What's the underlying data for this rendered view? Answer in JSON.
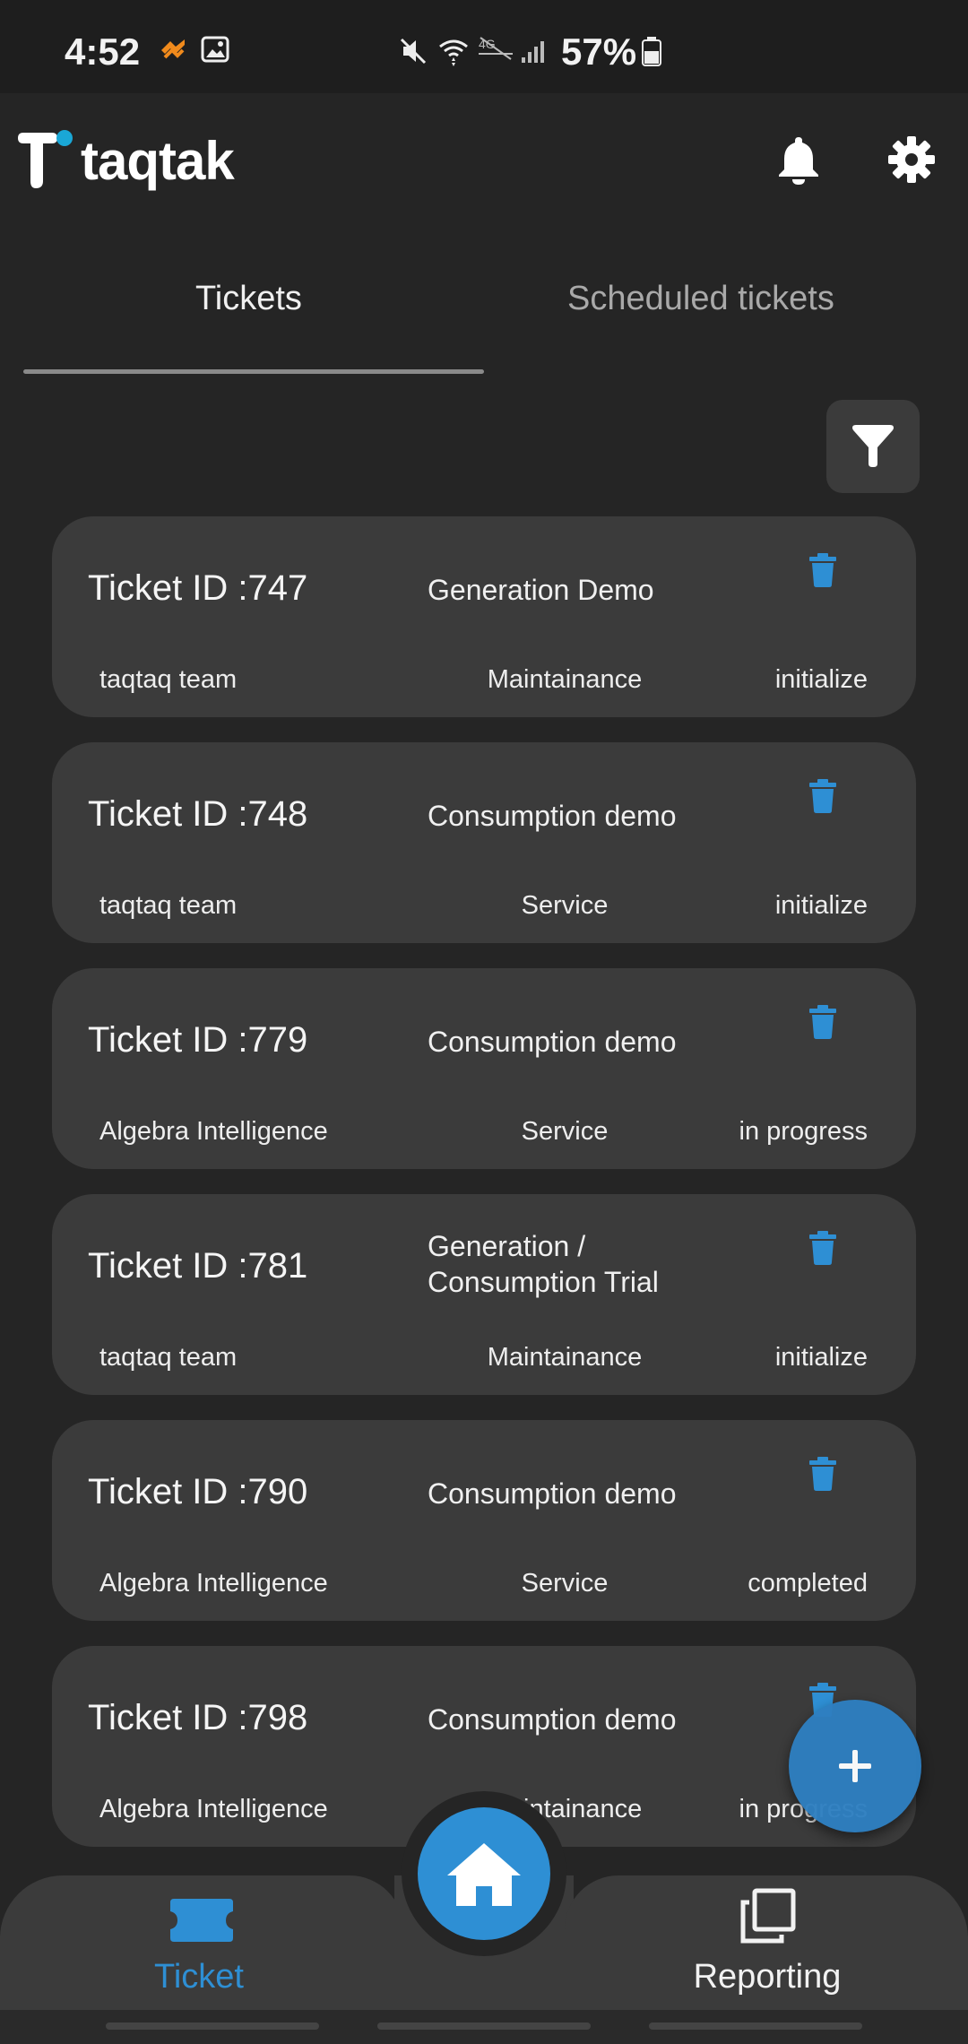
{
  "status_bar": {
    "time": "4:52",
    "battery": "57%",
    "icons": [
      "orange-app-icon",
      "gallery-icon",
      "mute-icon",
      "wifi-icon",
      "4g-icon",
      "signal-icon",
      "battery-icon"
    ]
  },
  "header": {
    "logo_text": "taqtak",
    "icons": [
      "bell-icon",
      "gear-icon"
    ]
  },
  "tabs": [
    {
      "label": "Tickets",
      "active": true
    },
    {
      "label": "Scheduled tickets",
      "active": false
    }
  ],
  "colors": {
    "accent": "#2e8fd4",
    "card": "#3b3b3b",
    "background": "#252525"
  },
  "tickets": [
    {
      "id": "Ticket ID :747",
      "name": "Generation Demo",
      "client": "taqtaq team",
      "type": "Maintainance",
      "status": "initialize"
    },
    {
      "id": "Ticket ID :748",
      "name": "Consumption demo",
      "client": "taqtaq team",
      "type": "Service",
      "status": "initialize"
    },
    {
      "id": "Ticket ID :779",
      "name": "Consumption demo",
      "client": "Algebra Intelligence",
      "type": "Service",
      "status": "in progress"
    },
    {
      "id": "Ticket ID :781",
      "name": "Generation / Consumption Trial",
      "client": "taqtaq team",
      "type": "Maintainance",
      "status": "initialize"
    },
    {
      "id": "Ticket ID :790",
      "name": "Consumption demo",
      "client": "Algebra Intelligence",
      "type": "Service",
      "status": "completed"
    },
    {
      "id": "Ticket ID :798",
      "name": "Consumption demo",
      "client": "Algebra Intelligence",
      "type": "Maintainance",
      "status": "in progress"
    }
  ],
  "bottom_nav": {
    "ticket_label": "Ticket",
    "reporting_label": "Reporting"
  }
}
